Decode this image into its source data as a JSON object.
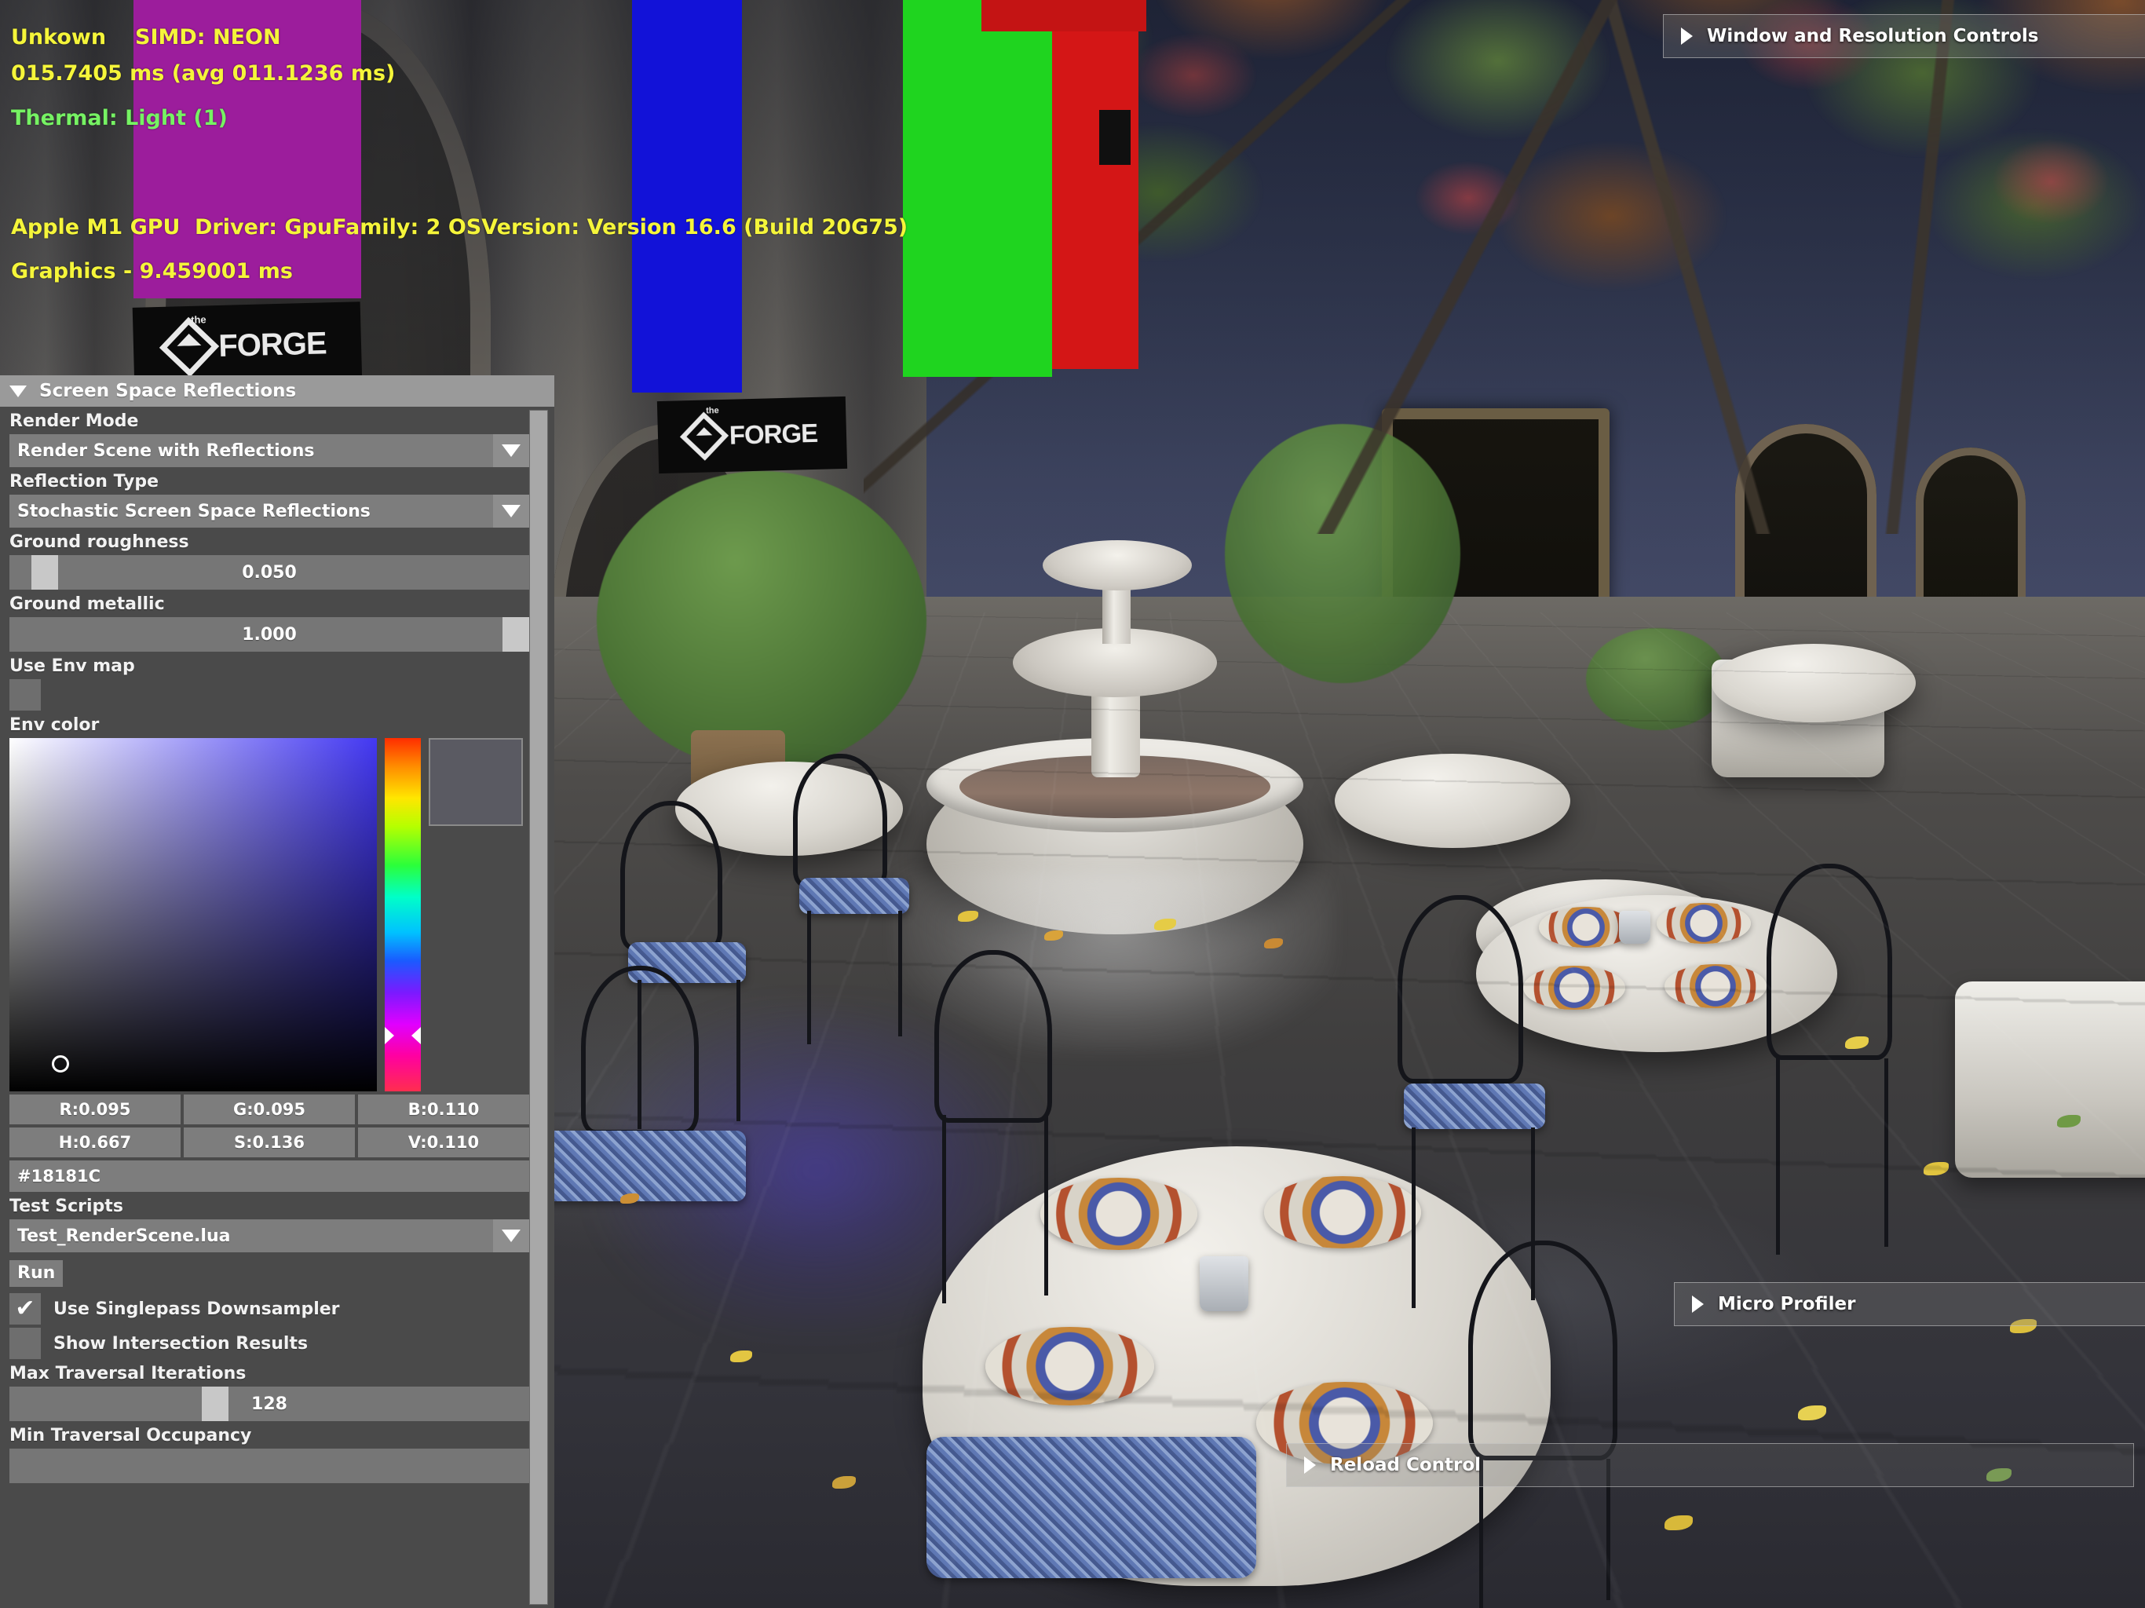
{
  "hud": {
    "line1_left": "Unkown",
    "line1_right": "SIMD: NEON",
    "line2": "015.7405 ms (avg 011.1236 ms)",
    "line3": "Thermal: Light (1)",
    "line4_left": "Apple M1 GPU",
    "line4_right": "Driver: GpuFamily: 2 OSVersion: Version 16.6 (Build 20G75)",
    "line5": "Graphics - 9.459001 ms",
    "color_yellow": "#f5f53a",
    "color_green": "#76f263"
  },
  "branding": {
    "logo_word": "FORGE",
    "logo_the": "the"
  },
  "panel": {
    "title": "Screen Space Reflections",
    "collapse_icon": "triangle-down-icon",
    "render_mode": {
      "label": "Render Mode",
      "value": "Render Scene with Reflections",
      "arrow_icon": "chevron-down-icon"
    },
    "reflection_type": {
      "label": "Reflection Type",
      "value": "Stochastic Screen Space Reflections",
      "arrow_icon": "chevron-down-icon"
    },
    "ground_roughness": {
      "label": "Ground roughness",
      "value": "0.050",
      "fraction": 0.05
    },
    "ground_metallic": {
      "label": "Ground metallic",
      "value": "1.000",
      "fraction": 1.0
    },
    "use_env_map": {
      "label": "Use Env map",
      "checked": false
    },
    "env_color": {
      "label": "Env color",
      "r": "R:0.095",
      "g": "G:0.095",
      "b": "B:0.110",
      "h": "H:0.667",
      "s": "S:0.136",
      "v": "V:0.110",
      "hex": "#18181C",
      "swatch_hex": "#5a5a62"
    },
    "test_scripts": {
      "label": "Test Scripts",
      "value": "Test_RenderScene.lua",
      "arrow_icon": "chevron-down-icon"
    },
    "run_button": "Run",
    "use_singlepass_downsampler": {
      "label": "Use Singlepass Downsampler",
      "checked": true,
      "check_glyph": "✔"
    },
    "show_intersection_results": {
      "label": "Show Intersection Results",
      "checked": false
    },
    "max_traversal_iterations": {
      "label": "Max Traversal Iterations",
      "value": "128",
      "fraction": 0.5
    },
    "min_traversal_occupancy": {
      "label": "Min Traversal Occupancy"
    }
  },
  "collapsed_panels": [
    {
      "label": "Window and Resolution Controls",
      "expand_icon": "triangle-right-icon"
    },
    {
      "label": "Micro Profiler",
      "expand_icon": "triangle-right-icon"
    },
    {
      "label": "Reload Control",
      "expand_icon": "triangle-right-icon"
    }
  ]
}
